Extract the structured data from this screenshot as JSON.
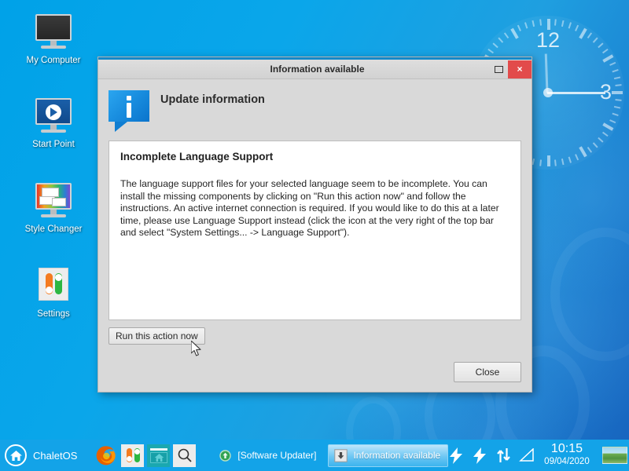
{
  "desktop": {
    "icons": [
      {
        "label": "My Computer",
        "icon": "monitor-icon"
      },
      {
        "label": "Start Point",
        "icon": "media-play-monitor-icon"
      },
      {
        "label": "Style Changer",
        "icon": "style-changer-monitor-icon"
      },
      {
        "label": "Settings",
        "icon": "toggles-icon"
      }
    ],
    "clock_widget": {
      "numeral_12": "12",
      "numeral_3": "3"
    },
    "wallpaper_color": "#00a2e8"
  },
  "dialog": {
    "title": "Information available",
    "header": "Update information",
    "icon": "info-bubble-icon",
    "window_buttons": {
      "maximize_label": "",
      "close_label": "×"
    },
    "content": {
      "heading": "Incomplete Language Support",
      "body": "The language support files for your selected language seem to be incomplete. You can install the missing components by clicking on \"Run this action now\" and follow the instructions. An active internet connection is required. If you would like to do this at a later time, please use Language Support instead (click the icon at the very right of the top bar and select \"System Settings... -> Language Support\")."
    },
    "run_button": "Run this action now",
    "close_button": "Close",
    "accent_color": "#1388c9",
    "close_button_color": "#e24b4b"
  },
  "taskbar": {
    "start": {
      "label": "ChaletOS",
      "icon": "home-icon"
    },
    "launchers": [
      {
        "name": "firefox-icon",
        "title": "Firefox"
      },
      {
        "name": "settings-toggles-icon",
        "title": "Settings"
      },
      {
        "name": "home-folder-icon",
        "title": "Home Folder"
      },
      {
        "name": "search-icon",
        "title": "Search"
      }
    ],
    "tasks": [
      {
        "label": "[Software Updater]",
        "icon": "software-updater-icon",
        "active": false
      },
      {
        "label": "Information available",
        "icon": "update-box-icon",
        "active": true
      }
    ],
    "tray_icons": [
      "power-bolt-icon",
      "power-bolt-icon",
      "network-updown-icon",
      "signal-triangle-icon"
    ],
    "clock": {
      "time": "10:15",
      "date": "09/04/2020"
    },
    "thumbnail": "landscape-thumbnail",
    "background_color": "#13a3e8"
  }
}
